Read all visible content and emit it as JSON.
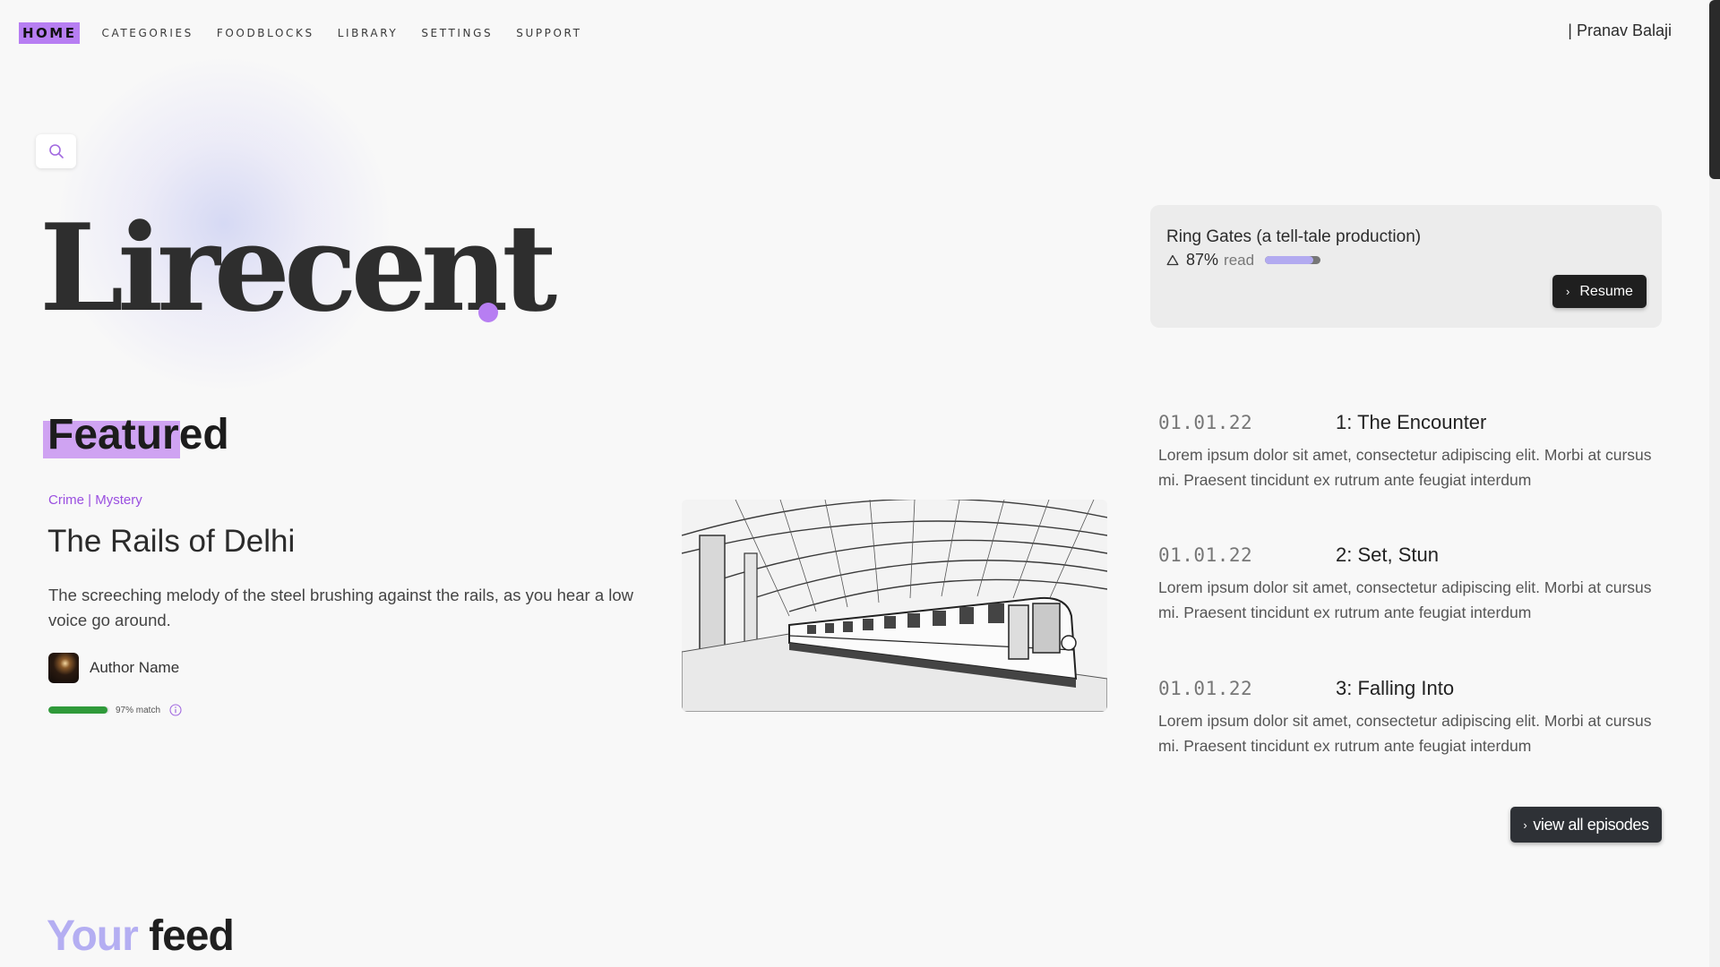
{
  "nav": {
    "items": [
      {
        "label": "HOME",
        "active": true
      },
      {
        "label": "CATEGORIES",
        "active": false
      },
      {
        "label": "FOODBLOCKS",
        "active": false
      },
      {
        "label": "LIBRARY",
        "active": false
      },
      {
        "label": "SETTINGS",
        "active": false
      },
      {
        "label": "SUPPORT",
        "active": false
      }
    ],
    "user": "| Pranav Balaji"
  },
  "search": {
    "icon": "search-icon"
  },
  "brand": {
    "name": "Lirecent",
    "accent_color": "#b77ef2"
  },
  "continue_reading": {
    "title": "Ring Gates (a tell-tale production)",
    "progress_label": "87%",
    "progress_suffix": "read",
    "progress": 0.87,
    "resume_label": "Resume"
  },
  "featured": {
    "heading": "Featured",
    "genres": "Crime | Mystery",
    "title": "The Rails of Delhi",
    "description": "The screeching melody of the steel brushing against the rails, as you hear a low voice go around.",
    "author": "Author Name",
    "match_label": "97% match",
    "match": 0.97
  },
  "episodes": [
    {
      "date": "01.01.22",
      "title": "1: The Encounter",
      "description": "Lorem ipsum dolor sit amet, consectetur adipiscing elit.  Morbi at cursus mi. Praesent tincidunt ex rutrum ante feugiat interdum"
    },
    {
      "date": "01.01.22",
      "title": "2: Set, Stun",
      "description": "Lorem ipsum dolor sit amet, consectetur adipiscing elit.  Morbi at cursus mi. Praesent tincidunt ex rutrum ante feugiat interdum"
    },
    {
      "date": "01.01.22",
      "title": "3: Falling Into",
      "description": "Lorem ipsum dolor sit amet, consectetur adipiscing elit.  Morbi at cursus mi. Praesent tincidunt ex rutrum ante feugiat interdum"
    }
  ],
  "view_all_label": "view all episodes",
  "feed": {
    "word1": "Your",
    "word2": "feed"
  }
}
